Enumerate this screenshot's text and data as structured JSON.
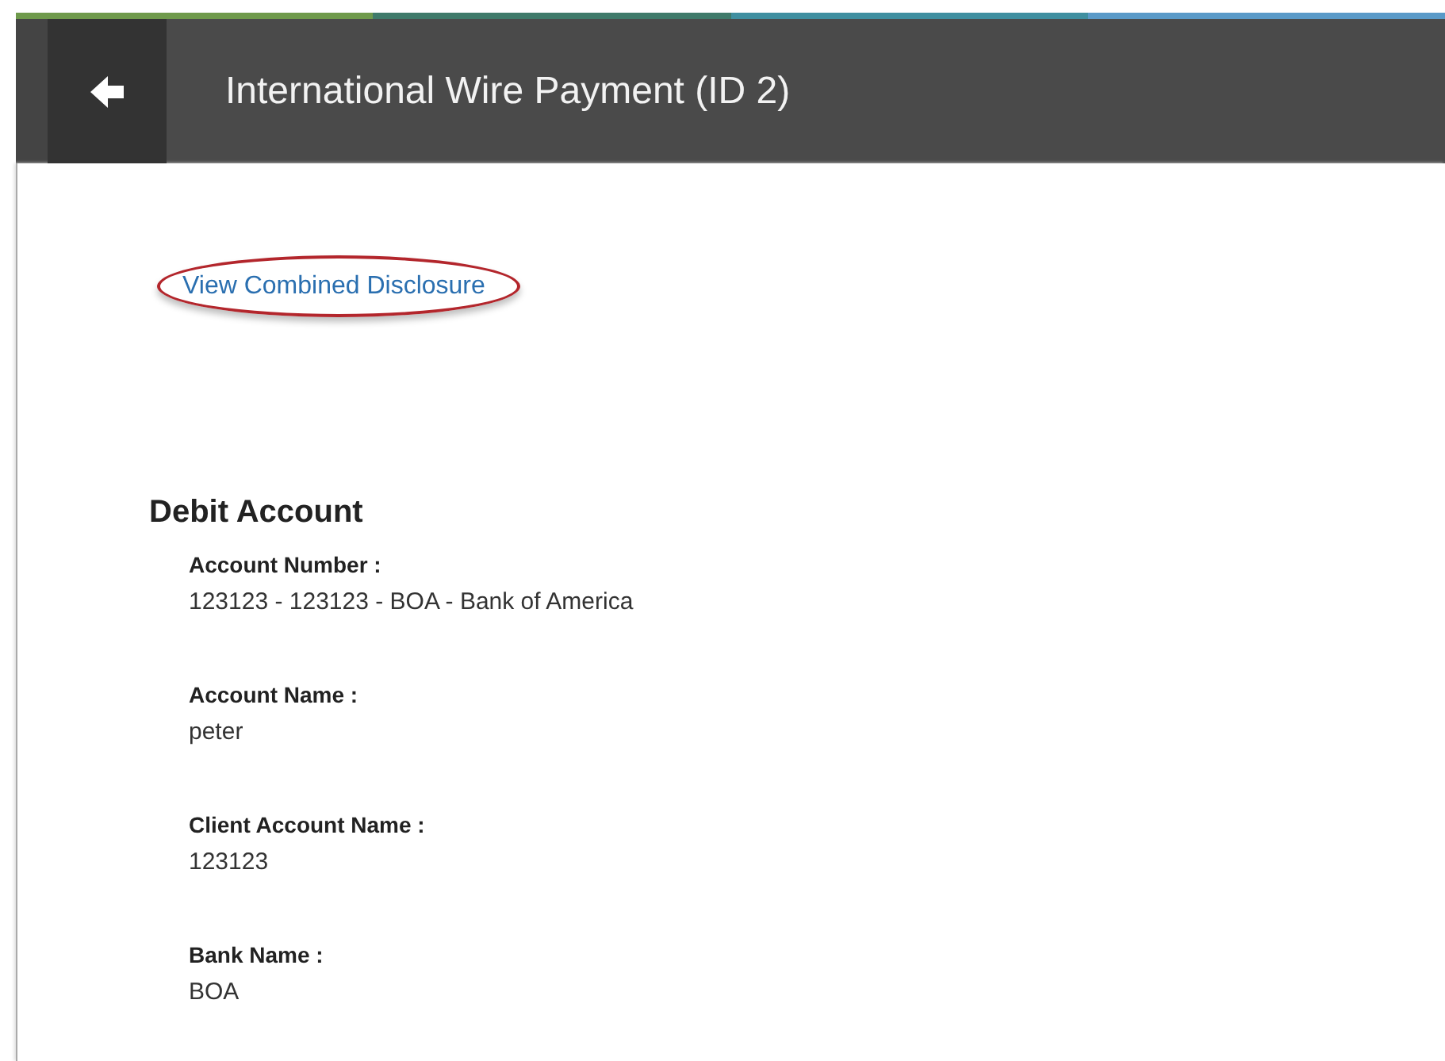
{
  "header": {
    "title": "International Wire Payment (ID 2)"
  },
  "disclosure_link": "View Combined Disclosure",
  "section": {
    "title": "Debit Account",
    "fields": [
      {
        "label": "Account Number :",
        "value": "123123 - 123123 - BOA - Bank of America"
      },
      {
        "label": "Account Name :",
        "value": "peter"
      },
      {
        "label": "Client Account Name :",
        "value": "123123"
      },
      {
        "label": "Bank Name :",
        "value": "BOA"
      }
    ]
  }
}
